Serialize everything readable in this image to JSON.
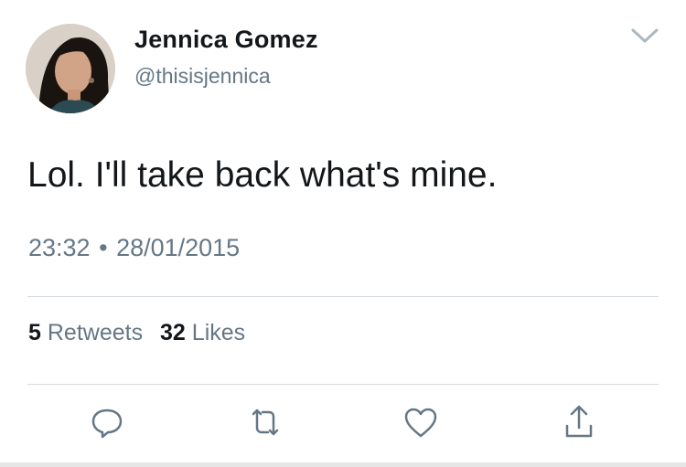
{
  "tweet": {
    "author_name": "Jennica Gomez",
    "author_handle": "@thisisjennica",
    "text": "Lol. I'll take back what's mine.",
    "time": "23:32",
    "separator": "•",
    "date": "28/01/2015",
    "retweets_count": "5",
    "retweets_label": "Retweets",
    "likes_count": "32",
    "likes_label": "Likes"
  },
  "icons": {
    "menu": "chevron-down-icon",
    "reply": "reply-icon",
    "retweet": "retweet-icon",
    "like": "heart-icon",
    "share": "share-icon"
  },
  "colors": {
    "primary_text": "#14171a",
    "secondary_text": "#657786",
    "icon": "#657786",
    "divider": "#d5dbe0"
  }
}
